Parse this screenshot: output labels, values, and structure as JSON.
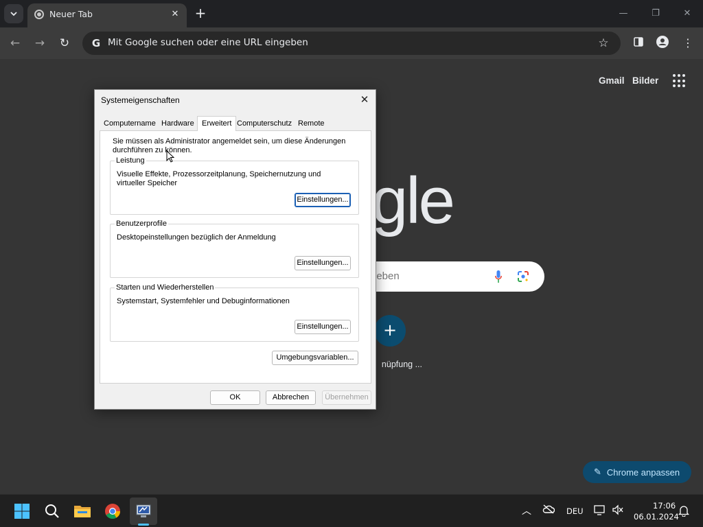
{
  "browser": {
    "tab": {
      "title": "Neuer Tab"
    },
    "omnibox": {
      "text": "Mit Google suchen oder eine URL eingeben"
    }
  },
  "ntp": {
    "links": {
      "gmail": "Gmail",
      "images": "Bilder"
    },
    "logo_visible": "gle",
    "search_placeholder_visible": "geben",
    "shortcut_label_visible": "nüpfung ...",
    "customize_label": "Chrome anpassen"
  },
  "dialog": {
    "title": "Systemeigenschaften",
    "tabs": [
      {
        "label": "Computername"
      },
      {
        "label": "Hardware"
      },
      {
        "label": "Erweitert",
        "active": true
      },
      {
        "label": "Computerschutz"
      },
      {
        "label": "Remote"
      }
    ],
    "admin_note": "Sie müssen als Administrator angemeldet sein, um diese Änderungen durchführen zu können.",
    "groups": [
      {
        "title": "Leistung",
        "description": "Visuelle Effekte, Prozessorzeitplanung, Speichernutzung und virtueller Speicher",
        "button": "Einstellungen..."
      },
      {
        "title": "Benutzerprofile",
        "description": "Desktopeinstellungen bezüglich der Anmeldung",
        "button": "Einstellungen..."
      },
      {
        "title": "Starten und Wiederherstellen",
        "description": "Systemstart, Systemfehler und Debuginformationen",
        "button": "Einstellungen..."
      }
    ],
    "env_button": "Umgebungsvariablen...",
    "buttons": {
      "ok": "OK",
      "cancel": "Abbrechen",
      "apply": "Übernehmen"
    }
  },
  "taskbar": {
    "language": "DEU",
    "time": "17:06",
    "date": "06.01.2024"
  },
  "colors": {
    "ntp_background": "#353535",
    "toolbar": "#3c3c3c",
    "accent": "#0d4a6e",
    "taskbar_indicator": "#4cc2ff"
  }
}
